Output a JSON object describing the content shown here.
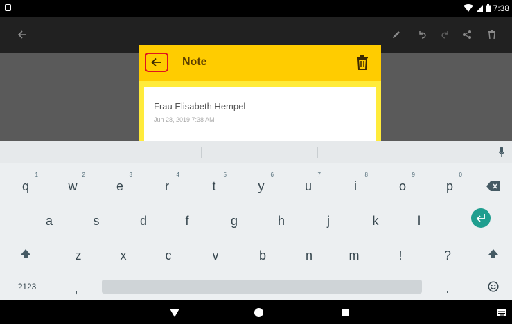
{
  "status_bar": {
    "time": "7:38"
  },
  "dialog": {
    "title": "Note",
    "note_title": "Frau Elisabeth Hempel",
    "note_date": "Jun 28, 2019 7:38 AM"
  },
  "colors": {
    "dialog_header": "#ffcc00",
    "dialog_body": "#ffeb3b",
    "highlight": "#e0141e",
    "enter_key": "#1f9e8f"
  },
  "keyboard": {
    "row1": [
      {
        "key": "q",
        "hint": "1"
      },
      {
        "key": "w",
        "hint": "2"
      },
      {
        "key": "e",
        "hint": "3"
      },
      {
        "key": "r",
        "hint": "4"
      },
      {
        "key": "t",
        "hint": "5"
      },
      {
        "key": "y",
        "hint": "6"
      },
      {
        "key": "u",
        "hint": "7"
      },
      {
        "key": "i",
        "hint": "8"
      },
      {
        "key": "o",
        "hint": "9"
      },
      {
        "key": "p",
        "hint": "0"
      }
    ],
    "row2": [
      "a",
      "s",
      "d",
      "f",
      "g",
      "h",
      "j",
      "k",
      "l"
    ],
    "row3": [
      "z",
      "x",
      "c",
      "v",
      "b",
      "n",
      "m",
      "!",
      "?"
    ],
    "row4": {
      "symbols": "?123",
      "comma": ",",
      "period": "."
    }
  }
}
